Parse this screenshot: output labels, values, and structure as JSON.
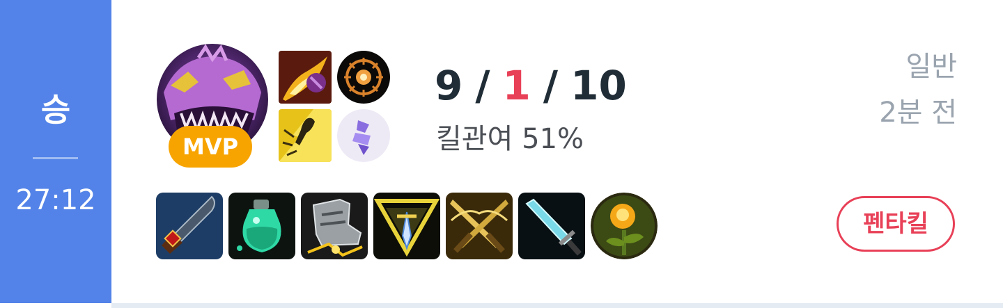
{
  "result": {
    "label": "승",
    "duration": "27:12",
    "color": "#5383e8"
  },
  "champion": {
    "icon": "cho-gath-champion-portrait",
    "badge": "MVP",
    "badge_color": "#f7a400"
  },
  "spells": [
    {
      "name": "ignite-spell-icon"
    },
    {
      "name": "flash-spell-icon"
    }
  ],
  "runes": [
    {
      "name": "electrocute-rune-icon"
    },
    {
      "name": "sorcery-rune-icon"
    }
  ],
  "kda": {
    "kills": "9",
    "deaths": "1",
    "assists": "10",
    "separator": "/",
    "death_color": "#e84057"
  },
  "kill_participation": "킬관여 51%",
  "queue_type": "일반",
  "time_ago": "2분 전",
  "items": [
    {
      "name": "bloodthirster-dagger-item-icon"
    },
    {
      "name": "refillable-potion-item-icon"
    },
    {
      "name": "boots-item-icon"
    },
    {
      "name": "sword-crest-item-icon"
    },
    {
      "name": "crossed-swords-item-icon"
    },
    {
      "name": "glowing-blade-item-icon"
    },
    {
      "name": "oracle-lens-trinket-icon"
    }
  ],
  "multikill": {
    "label": "펜타킬",
    "color": "#e84057"
  }
}
